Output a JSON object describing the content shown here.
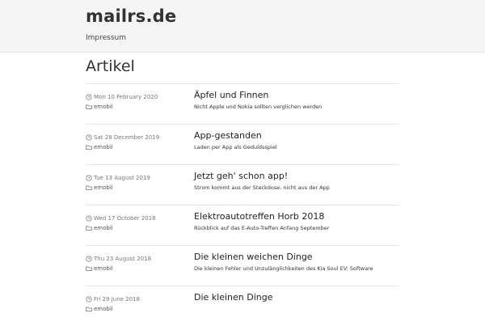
{
  "header": {
    "site_title": "mailrs.de",
    "nav": [
      {
        "label": "Impressum"
      }
    ]
  },
  "main": {
    "heading": "Artikel",
    "articles": [
      {
        "date": "Mon 10 February 2020",
        "category": "emobil",
        "title": "Äpfel und Finnen",
        "summary": "Nicht Apple und Nokia sollten verglichen werden"
      },
      {
        "date": "Sat 28 December 2019",
        "category": "emobil",
        "title": "App-gestanden",
        "summary": "Laden per App als Geduldsspiel"
      },
      {
        "date": "Tue 13 August 2019",
        "category": "emobil",
        "title": "Jetzt geh' schon app!",
        "summary": "Strom kommt aus der Steckdose, nicht aus der App"
      },
      {
        "date": "Wed 17 October 2018",
        "category": "emobil",
        "title": "Elektroautotreffen Horb 2018",
        "summary": "Rückblick auf das E-Auto-Treffen Anfang September"
      },
      {
        "date": "Thu 23 August 2018",
        "category": "emobil",
        "title": "Die kleinen weichen Dinge",
        "summary": "Die kleinen Fehler und Unzulänglichkeiten des Kia Soul EV: Software"
      },
      {
        "date": "Fri 29 June 2018",
        "category": "emobil",
        "title": "Die kleinen Dinge",
        "summary": ""
      }
    ]
  },
  "icons": {
    "date": "clock-icon",
    "category": "folder-icon"
  },
  "colors": {
    "header_bg": "#f5f5f5",
    "divider": "#e5e5e5",
    "meta_text": "#777777"
  }
}
